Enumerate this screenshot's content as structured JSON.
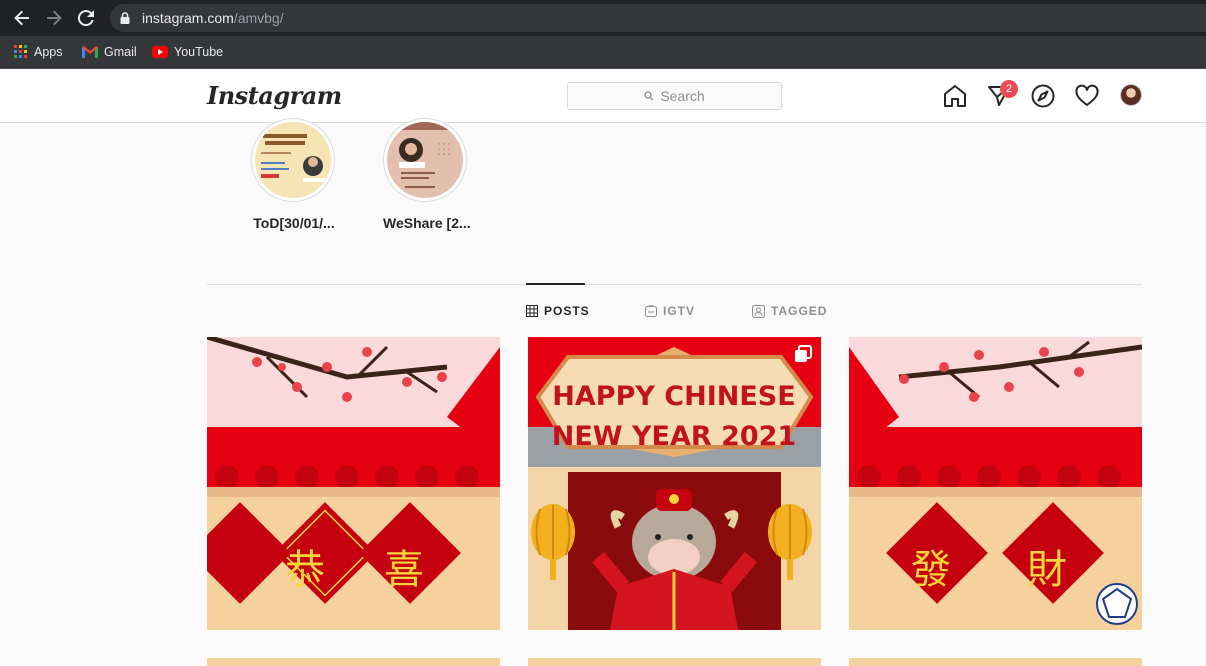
{
  "browser": {
    "url_host": "instagram.com",
    "url_path": "/amvbg/",
    "bookmarks": [
      {
        "label": "Apps"
      },
      {
        "label": "Gmail"
      },
      {
        "label": "YouTube"
      }
    ]
  },
  "header": {
    "logo": "Instagram",
    "search_placeholder": "Search",
    "direct_badge": "2"
  },
  "highlights": [
    {
      "label": "ToD[30/01/..."
    },
    {
      "label": "WeShare [2..."
    }
  ],
  "tabs": [
    {
      "label": "POSTS",
      "active": true
    },
    {
      "label": "IGTV",
      "active": false
    },
    {
      "label": "TAGGED",
      "active": false
    }
  ],
  "posts": [
    {
      "chars": [
        "恭",
        "喜"
      ]
    },
    {
      "title_line1": "HAPPY CHINESE",
      "title_line2": "NEW YEAR 2021"
    },
    {
      "chars": [
        "發",
        "財"
      ]
    }
  ],
  "colors": {
    "browser_bg": "#202124",
    "ig_text": "#262626",
    "badge": "#ed4956",
    "festive_red": "#e60012",
    "festive_gold": "#f5d29d"
  }
}
